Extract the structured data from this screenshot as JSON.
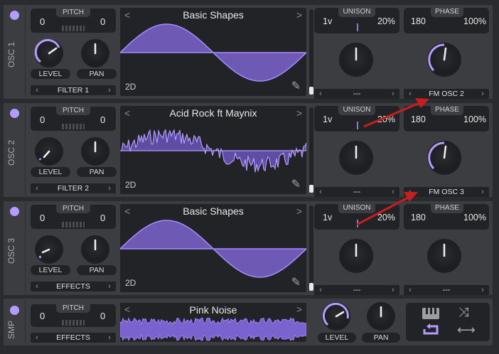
{
  "osc": [
    {
      "label": "OSC 1",
      "pitch": {
        "title": "PITCH",
        "left": "0",
        "right": "0"
      },
      "level_label": "LEVEL",
      "pan_label": "PAN",
      "destination": "FILTER 1",
      "wavetable": {
        "name": "Basic Shapes",
        "mode": "2D"
      },
      "unison": {
        "title": "UNISON",
        "voices": "1v",
        "detune": "20%",
        "selector": "---"
      },
      "phase": {
        "title": "PHASE",
        "value": "180",
        "randomize": "100%",
        "selector": "FM OSC 2"
      }
    },
    {
      "label": "OSC 2",
      "pitch": {
        "title": "PITCH",
        "left": "0",
        "right": "0"
      },
      "level_label": "LEVEL",
      "pan_label": "PAN",
      "destination": "FILTER 2",
      "wavetable": {
        "name": "Acid Rock ft Maynix",
        "mode": "2D"
      },
      "unison": {
        "title": "UNISON",
        "voices": "1v",
        "detune": "20%",
        "selector": "---"
      },
      "phase": {
        "title": "PHASE",
        "value": "180",
        "randomize": "100%",
        "selector": "FM OSC 3"
      }
    },
    {
      "label": "OSC 3",
      "pitch": {
        "title": "PITCH",
        "left": "0",
        "right": "0"
      },
      "level_label": "LEVEL",
      "pan_label": "PAN",
      "destination": "EFFECTS",
      "wavetable": {
        "name": "Basic Shapes",
        "mode": "2D"
      },
      "unison": {
        "title": "UNISON",
        "voices": "1v",
        "detune": "20%",
        "selector": "---"
      },
      "phase": {
        "title": "PHASE",
        "value": "180",
        "randomize": "100%",
        "selector": "---"
      }
    }
  ],
  "smp": {
    "label": "SMP",
    "pitch": {
      "title": "PITCH",
      "left": "0",
      "right": "0"
    },
    "destination": "EFFECTS",
    "sample_name": "Pink Noise",
    "level_label": "LEVEL",
    "pan_label": "PAN",
    "icons": [
      "keyboard-icon",
      "shuffle-icon",
      "loop-icon",
      "bounce-icon"
    ]
  },
  "colors": {
    "accent": "#b49cff",
    "annotation_arrow": "#c81e1e",
    "panel": "#3c3d41",
    "display": "#222326"
  }
}
